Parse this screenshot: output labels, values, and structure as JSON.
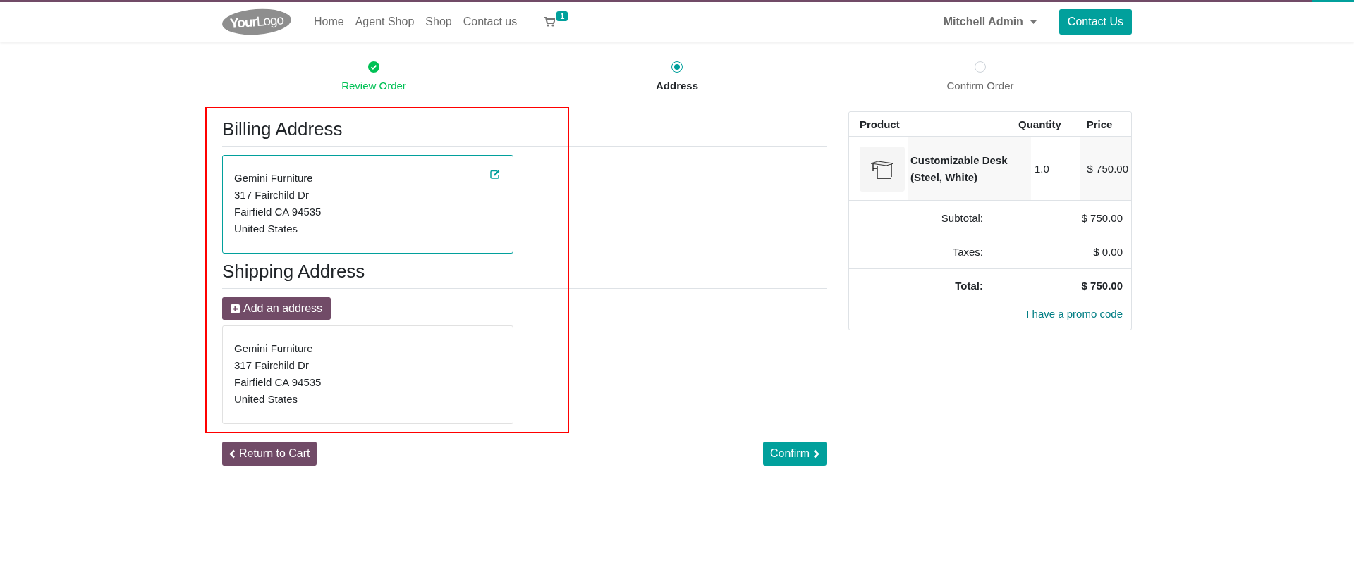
{
  "navbar": {
    "logo": [
      "Your",
      "Logo"
    ],
    "links": [
      {
        "label": "Home"
      },
      {
        "label": "Agent Shop"
      },
      {
        "label": "Shop"
      },
      {
        "label": "Contact us"
      }
    ],
    "cart": {
      "badge": "1"
    },
    "user": "Mitchell Admin",
    "cta": "Contact Us"
  },
  "steps": [
    {
      "label": "Review Order",
      "done": true,
      "selected": false
    },
    {
      "label": "Address",
      "done": false,
      "selected": true
    },
    {
      "label": "Confirm Order",
      "done": false,
      "selected": false
    }
  ],
  "billing": {
    "heading": "Billing Address",
    "addresses": [
      {
        "lines": [
          "Gemini Furniture",
          "317 Fairchild Dr",
          "Fairfield CA 94535",
          "United States"
        ],
        "selected": true,
        "editable": true
      }
    ]
  },
  "shipping": {
    "heading": "Shipping Address",
    "add_button": "Add an address",
    "addresses": [
      {
        "lines": [
          "Gemini Furniture",
          "317 Fairchild Dr",
          "Fairfield CA 94535",
          "United States"
        ],
        "selected": false,
        "editable": false
      }
    ]
  },
  "summary": {
    "columns": [
      "Product",
      "Quantity",
      "Price"
    ],
    "items": [
      {
        "name": "Customizable Desk (Steel, White)",
        "quantity": "1.0",
        "price": "$ 750.00"
      }
    ],
    "totals": [
      {
        "label": "Subtotal:",
        "value": "$ 750.00",
        "kind": "normal"
      },
      {
        "label": "Taxes:",
        "value": "$ 0.00",
        "kind": "normal"
      },
      {
        "label": "Total:",
        "value": "$ 750.00",
        "kind": "total"
      }
    ],
    "promo_link": "I have a promo code"
  },
  "actions": {
    "back": "Return to Cart",
    "next": "Confirm"
  }
}
